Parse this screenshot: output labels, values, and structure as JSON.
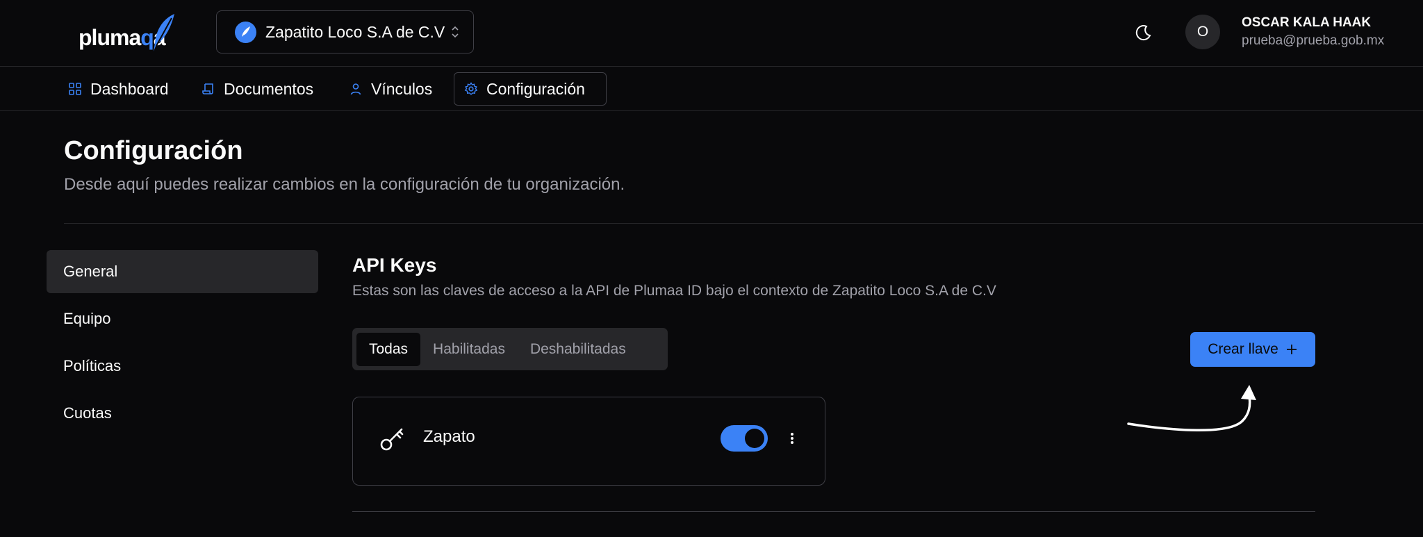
{
  "brand": {
    "logo_text_a": "pluma",
    "logo_text_b": "a",
    "accent": "#3b82f6"
  },
  "org_select": {
    "name": "Zapatito Loco S.A de C.V",
    "icon": "feather-icon"
  },
  "user": {
    "initial": "O",
    "name": "OSCAR KALA HAAK",
    "email": "prueba@prueba.gob.mx"
  },
  "nav": {
    "items": [
      {
        "label": "Dashboard",
        "icon": "grid-icon"
      },
      {
        "label": "Documentos",
        "icon": "scroll-icon"
      },
      {
        "label": "Vínculos",
        "icon": "user-icon"
      },
      {
        "label": "Configuración",
        "icon": "gear-icon",
        "active": true
      }
    ]
  },
  "page": {
    "title": "Configuración",
    "subtitle": "Desde aquí puedes realizar cambios en la configuración de tu organización."
  },
  "sidebar": {
    "items": [
      {
        "label": "General",
        "active": true
      },
      {
        "label": "Equipo"
      },
      {
        "label": "Políticas"
      },
      {
        "label": "Cuotas"
      }
    ]
  },
  "api_keys": {
    "title": "API Keys",
    "description": "Estas son las claves de acceso a la API de Plumaa ID bajo el contexto de Zapatito Loco S.A de C.V",
    "tabs": [
      {
        "label": "Todas",
        "active": true
      },
      {
        "label": "Habilitadas"
      },
      {
        "label": "Deshabilitadas"
      }
    ],
    "create_button": "Crear llave",
    "keys": [
      {
        "name": "Zapato",
        "enabled": true
      }
    ]
  }
}
